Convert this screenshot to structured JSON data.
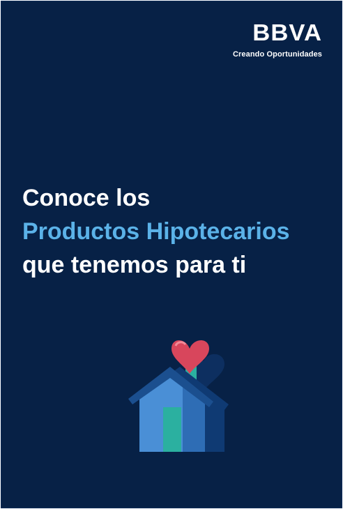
{
  "brand": {
    "logo_text": "BBVA",
    "tagline": "Creando Oportunidades"
  },
  "headline": {
    "line1": "Conoce los",
    "line2": "Productos Hipotecarios",
    "line3": "que tenemos para ti"
  },
  "colors": {
    "background": "#072146",
    "accent": "#5bb2e8",
    "text": "#ffffff",
    "house_light": "#4a8fd6",
    "house_dark": "#1b4f8f",
    "door": "#2bb0a0",
    "heart": "#d8465c"
  },
  "illustration": {
    "icon": "house-with-heart-icon"
  }
}
